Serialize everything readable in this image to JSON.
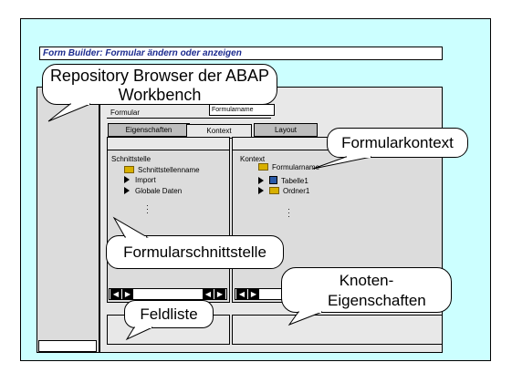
{
  "window": {
    "title": "Form Builder: Formular ändern oder anzeigen"
  },
  "form": {
    "label": "Formular",
    "field_value": "Formularname"
  },
  "tabs": [
    {
      "label": "Eigenschaften"
    },
    {
      "label": "Kontext"
    },
    {
      "label": "Layout"
    }
  ],
  "left_pane": {
    "header": "Schnittstelle",
    "items": [
      "Schnittstellenname",
      "Import",
      "Globale Daten"
    ]
  },
  "right_pane": {
    "header": "Kontext",
    "items": [
      "Formularname",
      "Tabelle1",
      "Ordner1"
    ]
  },
  "callouts": {
    "repository": "Repository Browser der ABAP Workbench",
    "formularkontext": "Formularkontext",
    "schnittstelle": "Formularschnittstelle",
    "feldliste": "Feldliste",
    "knoten": "Knoten-Eigenschaften"
  },
  "colors": {
    "background": "#ccffff",
    "title_text": "#1c2b8f",
    "pane": "#dcdcdc"
  }
}
